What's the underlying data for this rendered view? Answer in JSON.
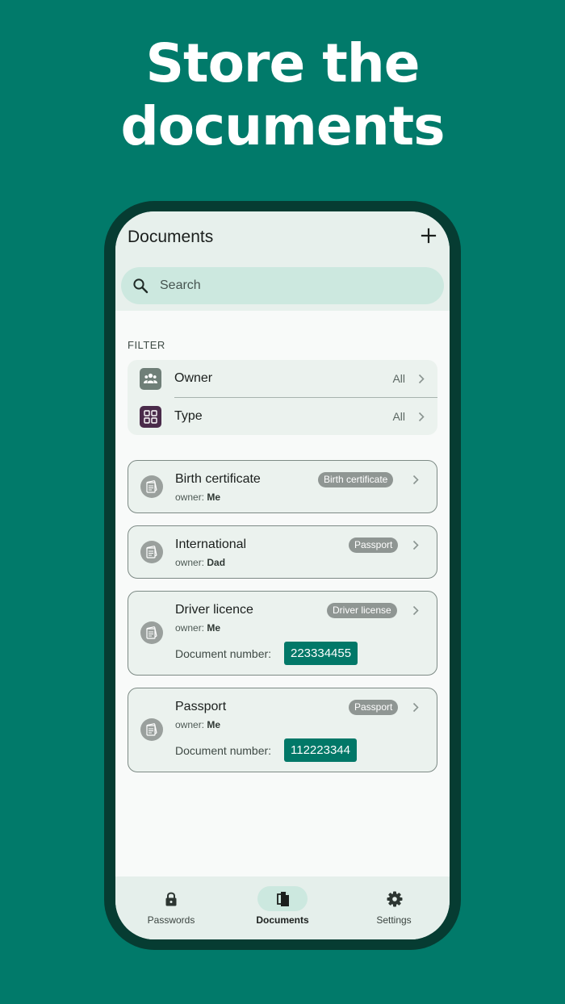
{
  "headline": {
    "line1": "Store the",
    "line2": "documents"
  },
  "appbar": {
    "title": "Documents",
    "add_icon": "plus-icon"
  },
  "search": {
    "placeholder": "Search",
    "value": "",
    "icon": "search-icon"
  },
  "filter": {
    "label": "FILTER",
    "rows": [
      {
        "name": "Owner",
        "value": "All",
        "icon": "people-icon",
        "color": "#6f7f78"
      },
      {
        "name": "Type",
        "value": "All",
        "icon": "grid-icon",
        "color": "#4a2b4a"
      }
    ]
  },
  "documents": [
    {
      "title": "Birth certificate",
      "owner_prefix": "owner:",
      "owner": "Me",
      "tag": "Birth certificate"
    },
    {
      "title": "International",
      "owner_prefix": "owner:",
      "owner": "Dad",
      "tag": "Passport"
    },
    {
      "title": "Driver licence",
      "owner_prefix": "owner:",
      "owner": "Me",
      "tag": "Driver license",
      "number_label": "Document number:",
      "number": "223334455"
    },
    {
      "title": "Passport",
      "owner_prefix": "owner:",
      "owner": "Me",
      "tag": "Passport",
      "number_label": "Document number:",
      "number": "112223344"
    }
  ],
  "nav": {
    "items": [
      {
        "label": "Passwords",
        "icon": "lock-icon",
        "active": false
      },
      {
        "label": "Documents",
        "icon": "document-icon",
        "active": true
      },
      {
        "label": "Settings",
        "icon": "gear-icon",
        "active": false
      }
    ]
  },
  "colors": {
    "background": "#017a6a",
    "phone_frame": "#063c32",
    "accent": "#027868",
    "search_fill": "#cce8df"
  }
}
